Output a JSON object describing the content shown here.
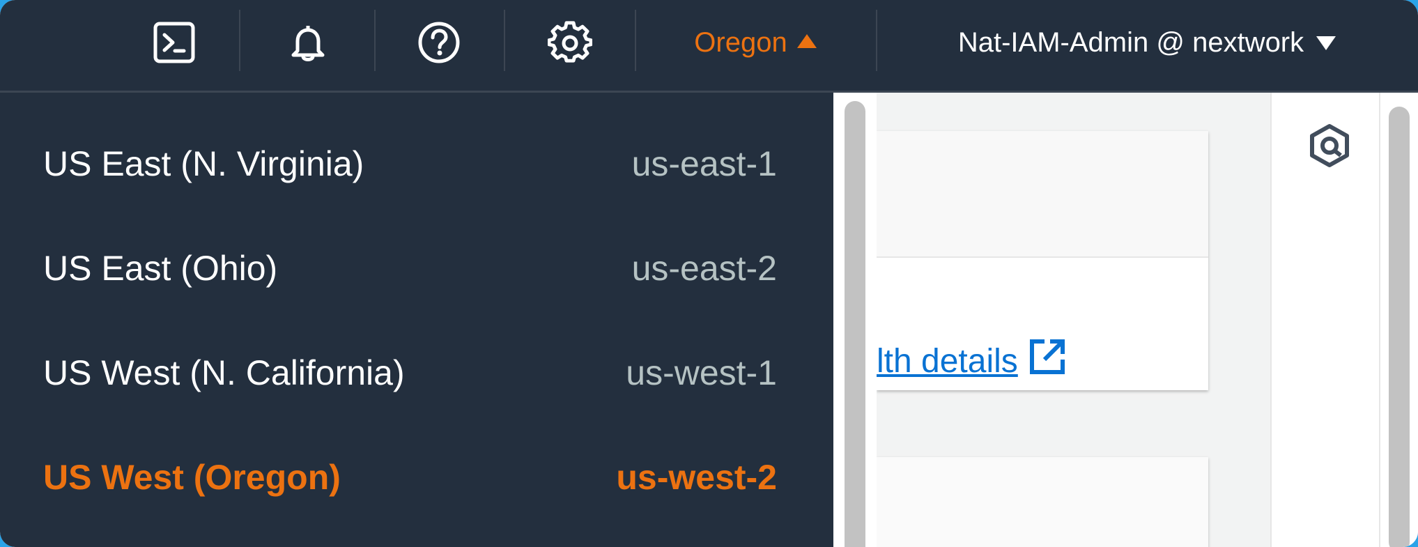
{
  "topbar": {
    "icons": {
      "cloudshell": "cloudshell-icon",
      "notifications": "bell-icon",
      "help": "help-icon",
      "settings": "gear-icon"
    },
    "region_label": "Oregon",
    "user_label": "Nat-IAM-Admin @ nextwork"
  },
  "region_dropdown": {
    "items": [
      {
        "name": "US East (N. Virginia)",
        "code": "us-east-1",
        "selected": false
      },
      {
        "name": "US East (Ohio)",
        "code": "us-east-2",
        "selected": false
      },
      {
        "name": "US West (N. California)",
        "code": "us-west-1",
        "selected": false
      },
      {
        "name": "US West (Oregon)",
        "code": "us-west-2",
        "selected": true
      }
    ]
  },
  "content": {
    "health_link_text": "lth details"
  },
  "colors": {
    "nav_bg": "#232f3e",
    "accent_orange": "#ec7211",
    "link_blue": "#0972d3",
    "code_gray": "#b5c2c3"
  }
}
